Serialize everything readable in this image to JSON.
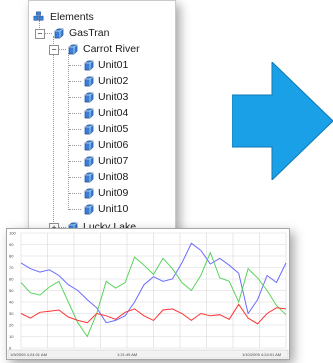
{
  "tree": {
    "root_label": "Elements",
    "level1_label": "GasTran",
    "level2_label": "Carrot River",
    "units": [
      "Unit01",
      "Unit02",
      "Unit03",
      "Unit04",
      "Unit05",
      "Unit06",
      "Unit07",
      "Unit08",
      "Unit09",
      "Unit10"
    ],
    "sibling_label": "Lucky Lake",
    "expander_open": "−",
    "expander_closed": "+"
  },
  "colors": {
    "tree_icon": "#3a7fd5",
    "arrow": "#1aa0e6",
    "series_blue": "#6b6bff",
    "series_green": "#5bd35b",
    "series_red": "#ff3333",
    "grid": "#d8d8d8"
  },
  "chart_data": {
    "type": "line",
    "title": "",
    "xlabel": "",
    "ylabel": "",
    "ylim": [
      0,
      100
    ],
    "y_ticks": [
      "100",
      "90",
      "80",
      "70",
      "60",
      "50",
      "40",
      "30",
      "20",
      "10",
      "0"
    ],
    "x_start_label": "1/9/2009 4:24:01 AM",
    "x_end_label": "1/10/2009 4:24:01 AM",
    "x_mid_label": "1:21:49 AM",
    "x": [
      0,
      1,
      2,
      3,
      4,
      5,
      6,
      7,
      8,
      9,
      10,
      11,
      12,
      13,
      14,
      15,
      16,
      17,
      18,
      19,
      20,
      21,
      22,
      23,
      24,
      25,
      26,
      27,
      28
    ],
    "series": [
      {
        "color": "#6b6bff",
        "values": [
          74,
          69,
          66,
          68,
          63,
          55,
          50,
          42,
          35,
          22,
          24,
          28,
          40,
          55,
          62,
          58,
          60,
          74,
          91,
          85,
          73,
          78,
          72,
          65,
          30,
          42,
          63,
          57,
          74
        ]
      },
      {
        "color": "#5bd35b",
        "values": [
          57,
          48,
          46,
          53,
          58,
          40,
          22,
          10,
          30,
          58,
          52,
          57,
          79,
          72,
          64,
          78,
          69,
          57,
          50,
          63,
          83,
          61,
          58,
          40,
          69,
          61,
          50,
          37,
          29
        ]
      },
      {
        "color": "#ff3333",
        "values": [
          30,
          26,
          31,
          32,
          33,
          27,
          24,
          22,
          30,
          28,
          25,
          31,
          34,
          28,
          24,
          33,
          34,
          30,
          24,
          30,
          28,
          29,
          25,
          38,
          26,
          21,
          30,
          35,
          34
        ]
      }
    ]
  }
}
